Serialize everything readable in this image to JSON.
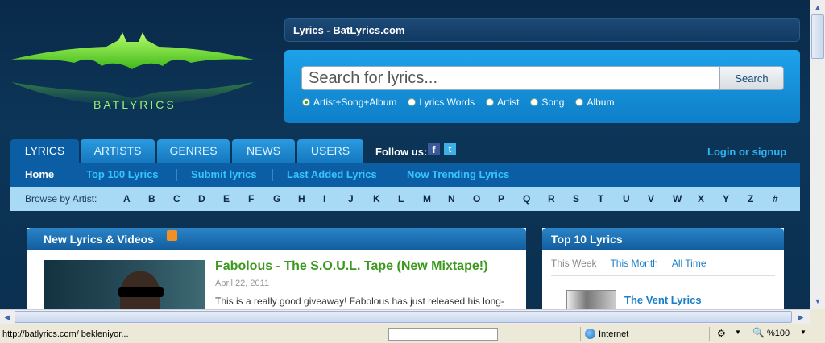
{
  "site": {
    "logo_text": "BATLYRICS",
    "title": "Lyrics - BatLyrics.com"
  },
  "search": {
    "placeholder": "Search for lyrics...",
    "button": "Search",
    "options": [
      {
        "label": "Artist+Song+Album",
        "selected": true
      },
      {
        "label": "Lyrics Words",
        "selected": false
      },
      {
        "label": "Artist",
        "selected": false
      },
      {
        "label": "Song",
        "selected": false
      },
      {
        "label": "Album",
        "selected": false
      }
    ]
  },
  "tabs": [
    {
      "label": "LYRICS",
      "active": true
    },
    {
      "label": "ARTISTS",
      "active": false
    },
    {
      "label": "GENRES",
      "active": false
    },
    {
      "label": "NEWS",
      "active": false
    },
    {
      "label": "USERS",
      "active": false
    }
  ],
  "follow_us": "Follow us:",
  "social": {
    "facebook": "f",
    "twitter": "t"
  },
  "login": "Login or signup",
  "nav": [
    "Home",
    "Top 100 Lyrics",
    "Submit lyrics",
    "Last Added Lyrics",
    "Now Trending Lyrics"
  ],
  "browse": {
    "label": "Browse by Artist:",
    "letters": [
      "A",
      "B",
      "C",
      "D",
      "E",
      "F",
      "G",
      "H",
      "I",
      "J",
      "K",
      "L",
      "M",
      "N",
      "O",
      "P",
      "Q",
      "R",
      "S",
      "T",
      "U",
      "V",
      "W",
      "X",
      "Y",
      "Z",
      "#"
    ]
  },
  "new_panel": {
    "title": "New Lyrics & Videos",
    "article_title": "Fabolous - The S.O.U.L. Tape (New Mixtape!)",
    "article_date": "April 22, 2011",
    "article_snippet": "This is a really good giveaway! Fabolous has just released his long-"
  },
  "top_panel": {
    "title": "Top 10 Lyrics",
    "tabs": [
      "This Week",
      "This Month",
      "All Time"
    ],
    "first_item": "The Vent Lyrics"
  },
  "status": {
    "url": "http://batlyrics.com/ bekleniyor...",
    "zone": "Internet",
    "zoom": "%100"
  },
  "colors": {
    "accent": "#1ea2ea",
    "nav_link": "#37c3ff",
    "article_title": "#3b9a1e",
    "logo": "#8be85a"
  }
}
